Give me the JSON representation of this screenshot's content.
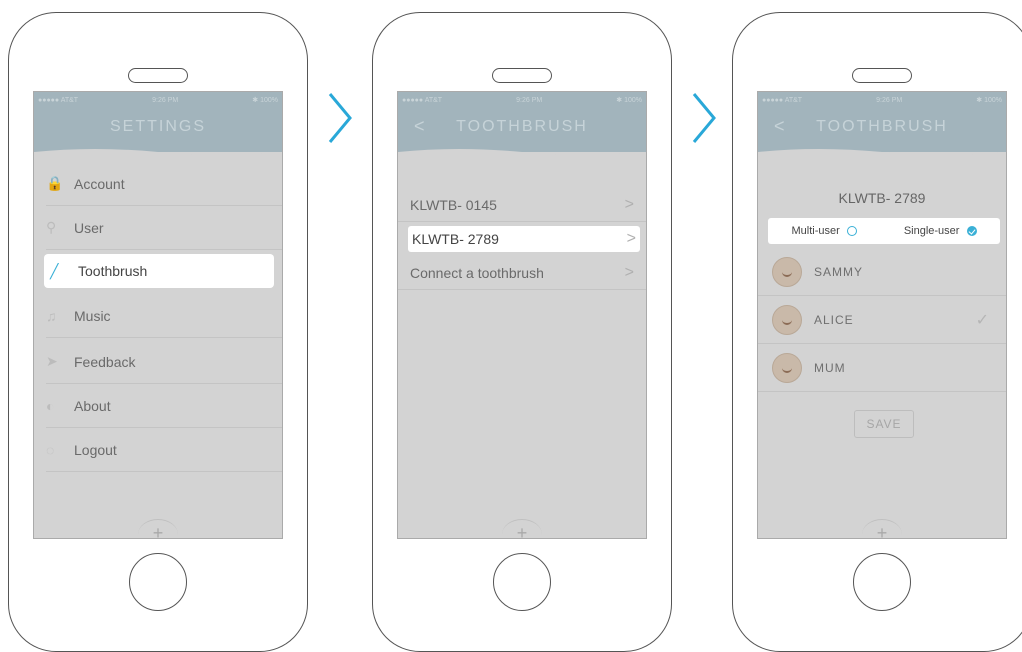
{
  "screen1": {
    "status": {
      "carrier": "●●●●● AT&T",
      "time": "9:26 PM",
      "battery": "✱ 100%"
    },
    "title": "SETTINGS",
    "menu": [
      {
        "icon": "lock-icon",
        "glyph": "🔒",
        "label": "Account"
      },
      {
        "icon": "user-icon",
        "glyph": "⚲",
        "label": "User"
      },
      {
        "icon": "toothbrush-icon",
        "glyph": "╱",
        "label": "Toothbrush",
        "active": true
      },
      {
        "icon": "music-icon",
        "glyph": "♫",
        "label": "Music"
      },
      {
        "icon": "feedback-icon",
        "glyph": "➤",
        "label": "Feedback"
      },
      {
        "icon": "about-icon",
        "glyph": "◐",
        "label": "About"
      },
      {
        "icon": "logout-icon",
        "glyph": "◌",
        "label": "Logout"
      }
    ],
    "plus": "+"
  },
  "screen2": {
    "status": {
      "carrier": "●●●●● AT&T",
      "time": "9:26 PM",
      "battery": "✱ 100%"
    },
    "back": "<",
    "title": "TOOTHBRUSH",
    "rows": [
      {
        "label": "KLWTB- 0145"
      },
      {
        "label": "KLWTB- 2789",
        "active": true
      },
      {
        "label": "Connect a toothbrush"
      }
    ],
    "plus": "+"
  },
  "screen3": {
    "status": {
      "carrier": "●●●●● AT&T",
      "time": "9:26 PM",
      "battery": "✱ 100%"
    },
    "back": "<",
    "title": "TOOTHBRUSH",
    "device": "KLWTB- 2789",
    "mode": {
      "multi": "Multi-user",
      "single": "Single-user",
      "selected": "single"
    },
    "users": [
      {
        "name": "SAMMY",
        "checked": false
      },
      {
        "name": "ALICE",
        "checked": true
      },
      {
        "name": "MUM",
        "checked": false
      }
    ],
    "check": "✓",
    "save": "SAVE",
    "plus": "+"
  },
  "chevron": ">"
}
